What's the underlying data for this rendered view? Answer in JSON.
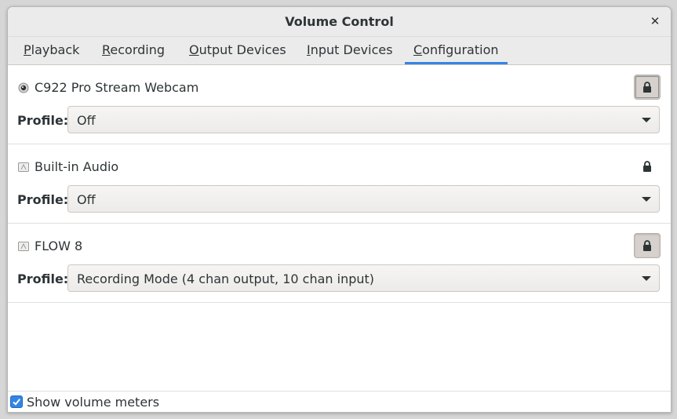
{
  "window": {
    "title": "Volume Control",
    "close_icon": "close-icon"
  },
  "tabs": [
    {
      "mnemonic": "P",
      "rest": "layback",
      "active": false
    },
    {
      "mnemonic": "R",
      "rest": "ecording",
      "active": false
    },
    {
      "mnemonic": "O",
      "rest": "utput Devices",
      "active": false
    },
    {
      "mnemonic": "I",
      "rest": "nput Devices",
      "active": false
    },
    {
      "mnemonic": "C",
      "rest": "onfiguration",
      "active": true
    }
  ],
  "devices": [
    {
      "name": "C922 Pro Stream Webcam",
      "icon": "webcam-icon",
      "lock_icon": "lock-icon",
      "lock_state": "pressed",
      "profile_label": "Profile:",
      "profile_value": "Off"
    },
    {
      "name": "Built-in Audio",
      "icon": "audio-card-icon",
      "lock_icon": "lock-icon",
      "lock_state": "flat",
      "profile_label": "Profile:",
      "profile_value": "Off"
    },
    {
      "name": "FLOW 8",
      "icon": "audio-card-icon",
      "lock_icon": "lock-icon",
      "lock_state": "pressed",
      "profile_label": "Profile:",
      "profile_value": "Recording Mode (4 chan output, 10 chan input)"
    }
  ],
  "footer": {
    "show_meters_label": "Show volume meters",
    "show_meters_checked": true
  },
  "colors": {
    "accent": "#3584e4",
    "text": "#2e3436",
    "header_bg": "#ebebeb"
  }
}
